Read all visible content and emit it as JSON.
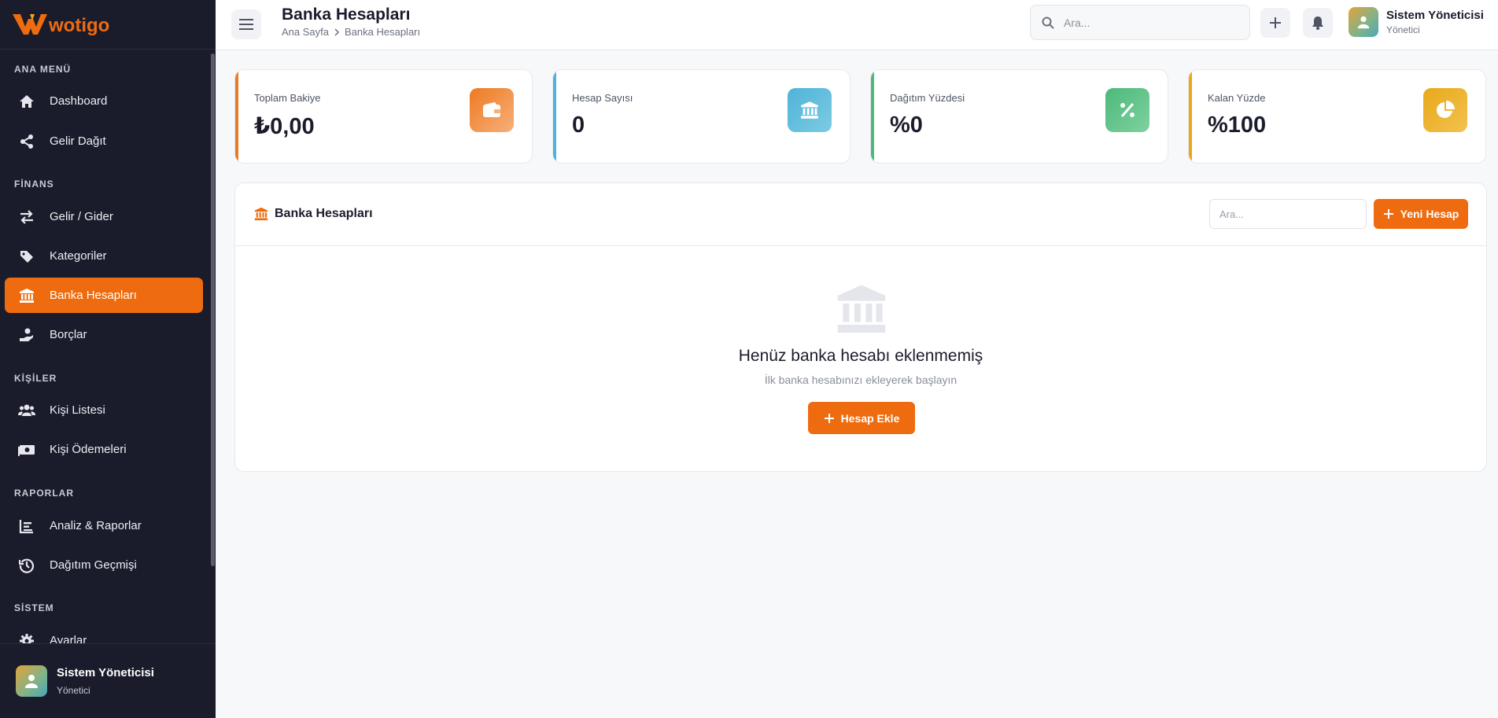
{
  "app": {
    "logo_text": "wotigo",
    "colors": {
      "accent": "#ee6c0f",
      "sidebar_bg": "#1b1c2b"
    }
  },
  "sidebar": {
    "sections": [
      {
        "title": "ANA MENÜ"
      },
      {
        "title": "FİNANS"
      },
      {
        "title": "KİŞİLER"
      },
      {
        "title": "RAPORLAR"
      },
      {
        "title": "SİSTEM"
      }
    ],
    "items": [
      {
        "label": "Dashboard",
        "icon": "home-icon"
      },
      {
        "label": "Gelir Dağıt",
        "icon": "share-icon"
      },
      {
        "label": "Gelir / Gider",
        "icon": "exchange-arrows-icon"
      },
      {
        "label": "Kategoriler",
        "icon": "tags-icon"
      },
      {
        "label": "Banka Hesapları",
        "icon": "bank-icon",
        "active": true
      },
      {
        "label": "Borçlar",
        "icon": "hand-coin-icon"
      },
      {
        "label": "Kişi Listesi",
        "icon": "users-icon"
      },
      {
        "label": "Kişi Ödemeleri",
        "icon": "money-bill-icon"
      },
      {
        "label": "Analiz & Raporlar",
        "icon": "chart-icon"
      },
      {
        "label": "Dağıtım Geçmişi",
        "icon": "history-icon"
      },
      {
        "label": "Ayarlar",
        "icon": "gear-icon"
      }
    ],
    "user": {
      "name": "Sistem Yöneticisi",
      "role": "Yönetici"
    }
  },
  "header": {
    "title": "Banka Hesapları",
    "breadcrumb": [
      "Ana Sayfa",
      "Banka Hesapları"
    ],
    "search_placeholder": "Ara...",
    "user": {
      "name": "Sistem Yöneticisi",
      "role": "Yönetici"
    }
  },
  "stats": [
    {
      "label": "Toplam Bakiye",
      "value": "₺0,00",
      "color": "#ee7a22",
      "icon": "wallet-icon"
    },
    {
      "label": "Hesap Sayısı",
      "value": "0",
      "color": "#4fb3d9",
      "icon": "bank-icon"
    },
    {
      "label": "Dağıtım Yüzdesi",
      "value": "%0",
      "color": "#4cb97a",
      "icon": "percent-icon"
    },
    {
      "label": "Kalan Yüzde",
      "value": "%100",
      "color": "#e9a81a",
      "icon": "pie-chart-icon"
    }
  ],
  "panel": {
    "title": "Banka Hesapları",
    "search_placeholder": "Ara...",
    "new_button": "Yeni Hesap",
    "empty_title": "Henüz banka hesabı eklenmemiş",
    "empty_subtitle": "İlk banka hesabınızı ekleyerek başlayın",
    "add_button": "Hesap Ekle"
  }
}
